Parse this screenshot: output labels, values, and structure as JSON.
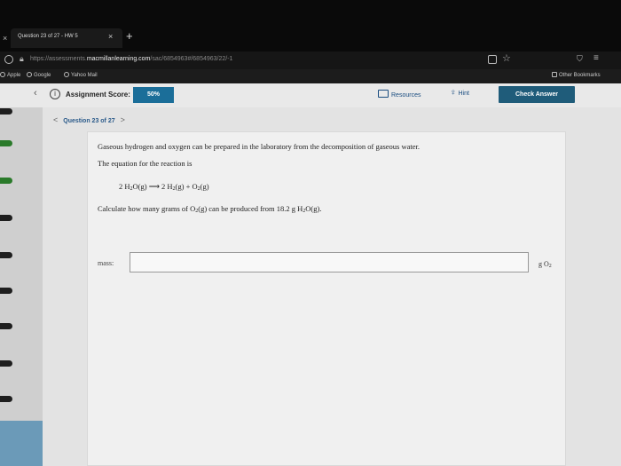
{
  "browser": {
    "tab_title": "Question 23 of 27 - HW 5",
    "tab_close": "×",
    "new_tab": "+",
    "url_scheme": "https://",
    "url_sub": "assessments.",
    "url_host": "macmillanlearning.com",
    "url_path": "/sac/6854963#/6854963/22/-1",
    "bookmarks": [
      "Apple",
      "Google",
      "Yahoo Mail"
    ],
    "other_bookmarks": "Other Bookmarks"
  },
  "header": {
    "score_label": "Assignment Score:",
    "score_value": "50%",
    "resources_label": "Resources",
    "hint_label": "Hint",
    "check_answer_label": "Check Answer"
  },
  "question_nav": {
    "prev": "<",
    "label": "Question 23 of 27",
    "next": ">"
  },
  "question": {
    "line1": "Gaseous hydrogen and oxygen can be prepared in the laboratory from the decomposition of gaseous water.",
    "line2": "The equation for the reaction is",
    "eq_parts": [
      "2 H",
      "2",
      "O(g)",
      "⟶",
      "2 H",
      "2",
      "(g) + O",
      "2",
      "(g)"
    ],
    "line3_parts": [
      "Calculate how many grams of O",
      "2",
      "(g) can be produced from 18.2 g H",
      "2",
      "O(g)."
    ]
  },
  "answer": {
    "mass_label": "mass:",
    "mass_value": "",
    "unit_parts": [
      "g O",
      "2"
    ]
  },
  "colors": {
    "score_badge": "#1b6e99",
    "check_answer": "#1f5c7a",
    "link": "#1a4d80"
  }
}
